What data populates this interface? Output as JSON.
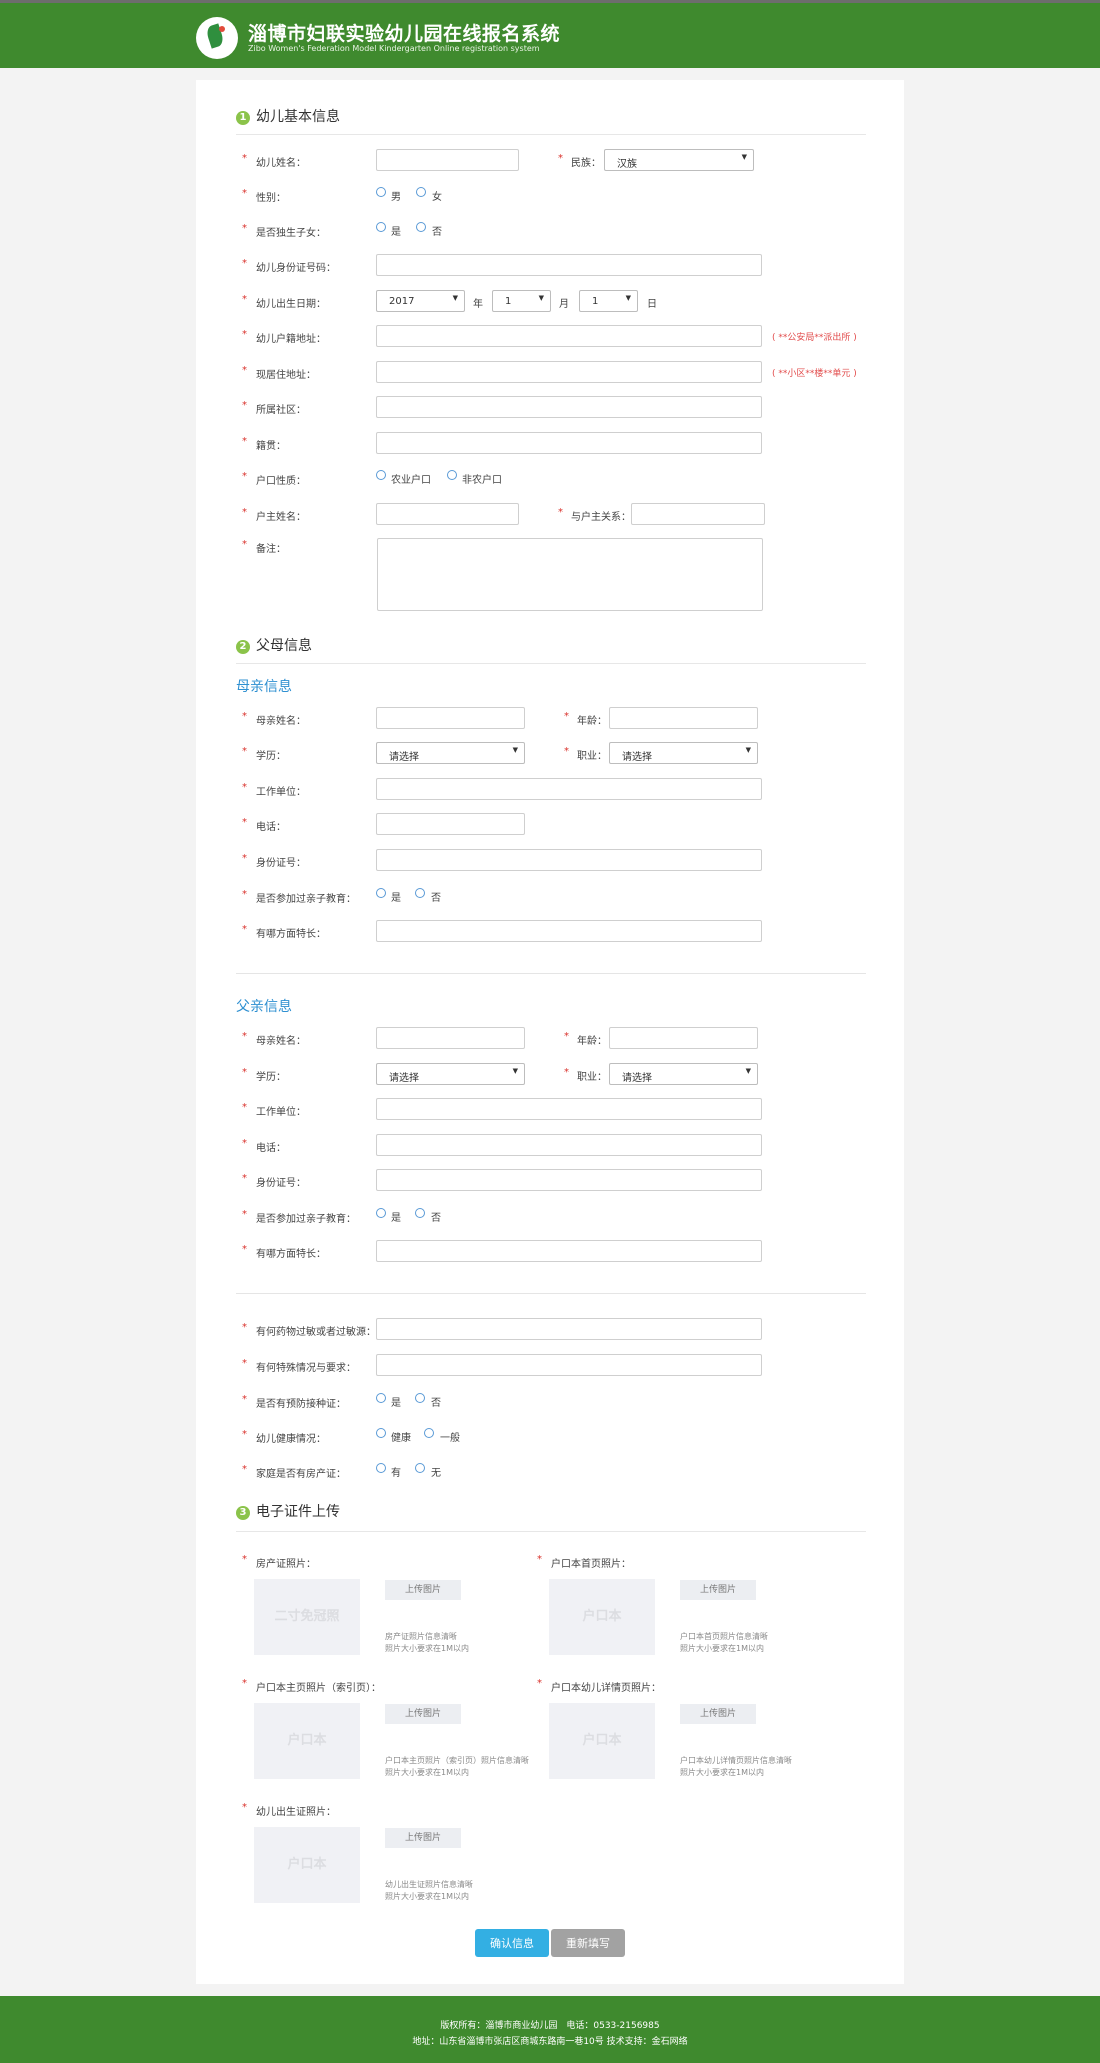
{
  "header": {
    "title": "淄博市妇联实验幼儿园在线报名系统",
    "subtitle": "Zibo Women's Federation Model Kindergarten Online registration system"
  },
  "section1": {
    "number": "1",
    "title": "幼儿基本信息",
    "child_name_label": "幼儿姓名：",
    "ethnicity_label": "民族：",
    "ethnicity_value": "汉族",
    "gender_label": "性别：",
    "gender_opt1": "男",
    "gender_opt2": "女",
    "only_child_label": "是否独生子女：",
    "only_child_opt1": "是",
    "only_child_opt2": "否",
    "id_label": "幼儿身份证号码：",
    "birth_label": "幼儿出生日期：",
    "birth_year": "2017",
    "year_unit": "年",
    "birth_month": "1",
    "month_unit": "月",
    "birth_day": "1",
    "day_unit": "日",
    "hukou_addr_label": "幼儿户籍地址：",
    "hukou_addr_hint": "( **公安局**派出所 )",
    "current_addr_label": "现居住地址：",
    "current_addr_hint": "( **小区**楼**单元 )",
    "community_label": "所属社区：",
    "native_label": "籍贯：",
    "hukou_type_label": "户口性质：",
    "hukou_opt1": "农业户口",
    "hukou_opt2": "非农户口",
    "householder_label": "户主姓名：",
    "relation_label": "与户主关系：",
    "remark_label": "备注："
  },
  "section2": {
    "number": "2",
    "title": "父母信息",
    "mother": {
      "title": "母亲信息",
      "name_label": "母亲姓名：",
      "age_label": "年龄：",
      "edu_label": "学历：",
      "edu_value": "请选择",
      "job_label": "职业：",
      "job_value": "请选择",
      "work_label": "工作单位：",
      "phone_label": "电话：",
      "id_label": "身份证号：",
      "edu_course_label": "是否参加过亲子教育：",
      "opt_yes": "是",
      "opt_no": "否",
      "talent_label": "有哪方面特长："
    },
    "father": {
      "title": "父亲信息",
      "name_label": "母亲姓名：",
      "age_label": "年龄：",
      "edu_label": "学历：",
      "edu_value": "请选择",
      "job_label": "职业：",
      "job_value": "请选择",
      "work_label": "工作单位：",
      "phone_label": "电话：",
      "id_label": "身份证号：",
      "edu_course_label": "是否参加过亲子教育：",
      "opt_yes": "是",
      "opt_no": "否",
      "talent_label": "有哪方面特长："
    }
  },
  "health": {
    "allergy_label": "有何药物过敏或者过敏源：",
    "special_label": "有何特殊情况与要求：",
    "vaccine_label": "是否有预防接种证：",
    "vaccine_yes": "是",
    "vaccine_no": "否",
    "health_label": "幼儿健康情况：",
    "health_opt1": "健康",
    "health_opt2": "一般",
    "property_label": "家庭是否有房产证：",
    "property_yes": "有",
    "property_no": "无"
  },
  "section3": {
    "number": "3",
    "title": "电子证件上传",
    "upload_label": "上传图片",
    "size_note": "照片大小要求在1M以内",
    "house": {
      "label": "房产证照片：",
      "placeholder": "二寸免冠照",
      "note": "房产证照片信息清晰"
    },
    "hukou_home": {
      "label": "户口本首页照片：",
      "placeholder": "户口本",
      "note": "户口本首页照片信息清晰"
    },
    "hukou_main": {
      "label": "户口本主页照片（索引页）：",
      "placeholder": "户口本",
      "note": "户口本主页照片（索引页）照片信息清晰"
    },
    "hukou_child": {
      "label": "户口本幼儿详情页照片：",
      "placeholder": "户口本",
      "note": "户口本幼儿详情页照片信息清晰"
    },
    "birth_cert": {
      "label": "幼儿出生证照片：",
      "placeholder": "户口本",
      "note": "幼儿出生证照片信息清晰"
    }
  },
  "actions": {
    "confirm": "确认信息",
    "reset": "重新填写"
  },
  "footer": {
    "line1": "版权所有：淄博市商业幼儿园　电话：0533-2156985",
    "line2": "地址：山东省淄博市张店区商城东路南一巷10号 技术支持：金石网络"
  },
  "colors": {
    "brand_green": "#3f8a2e",
    "accent_blue": "#33afe3",
    "required_red": "#d9302a",
    "section_blue": "#2f90d1"
  }
}
